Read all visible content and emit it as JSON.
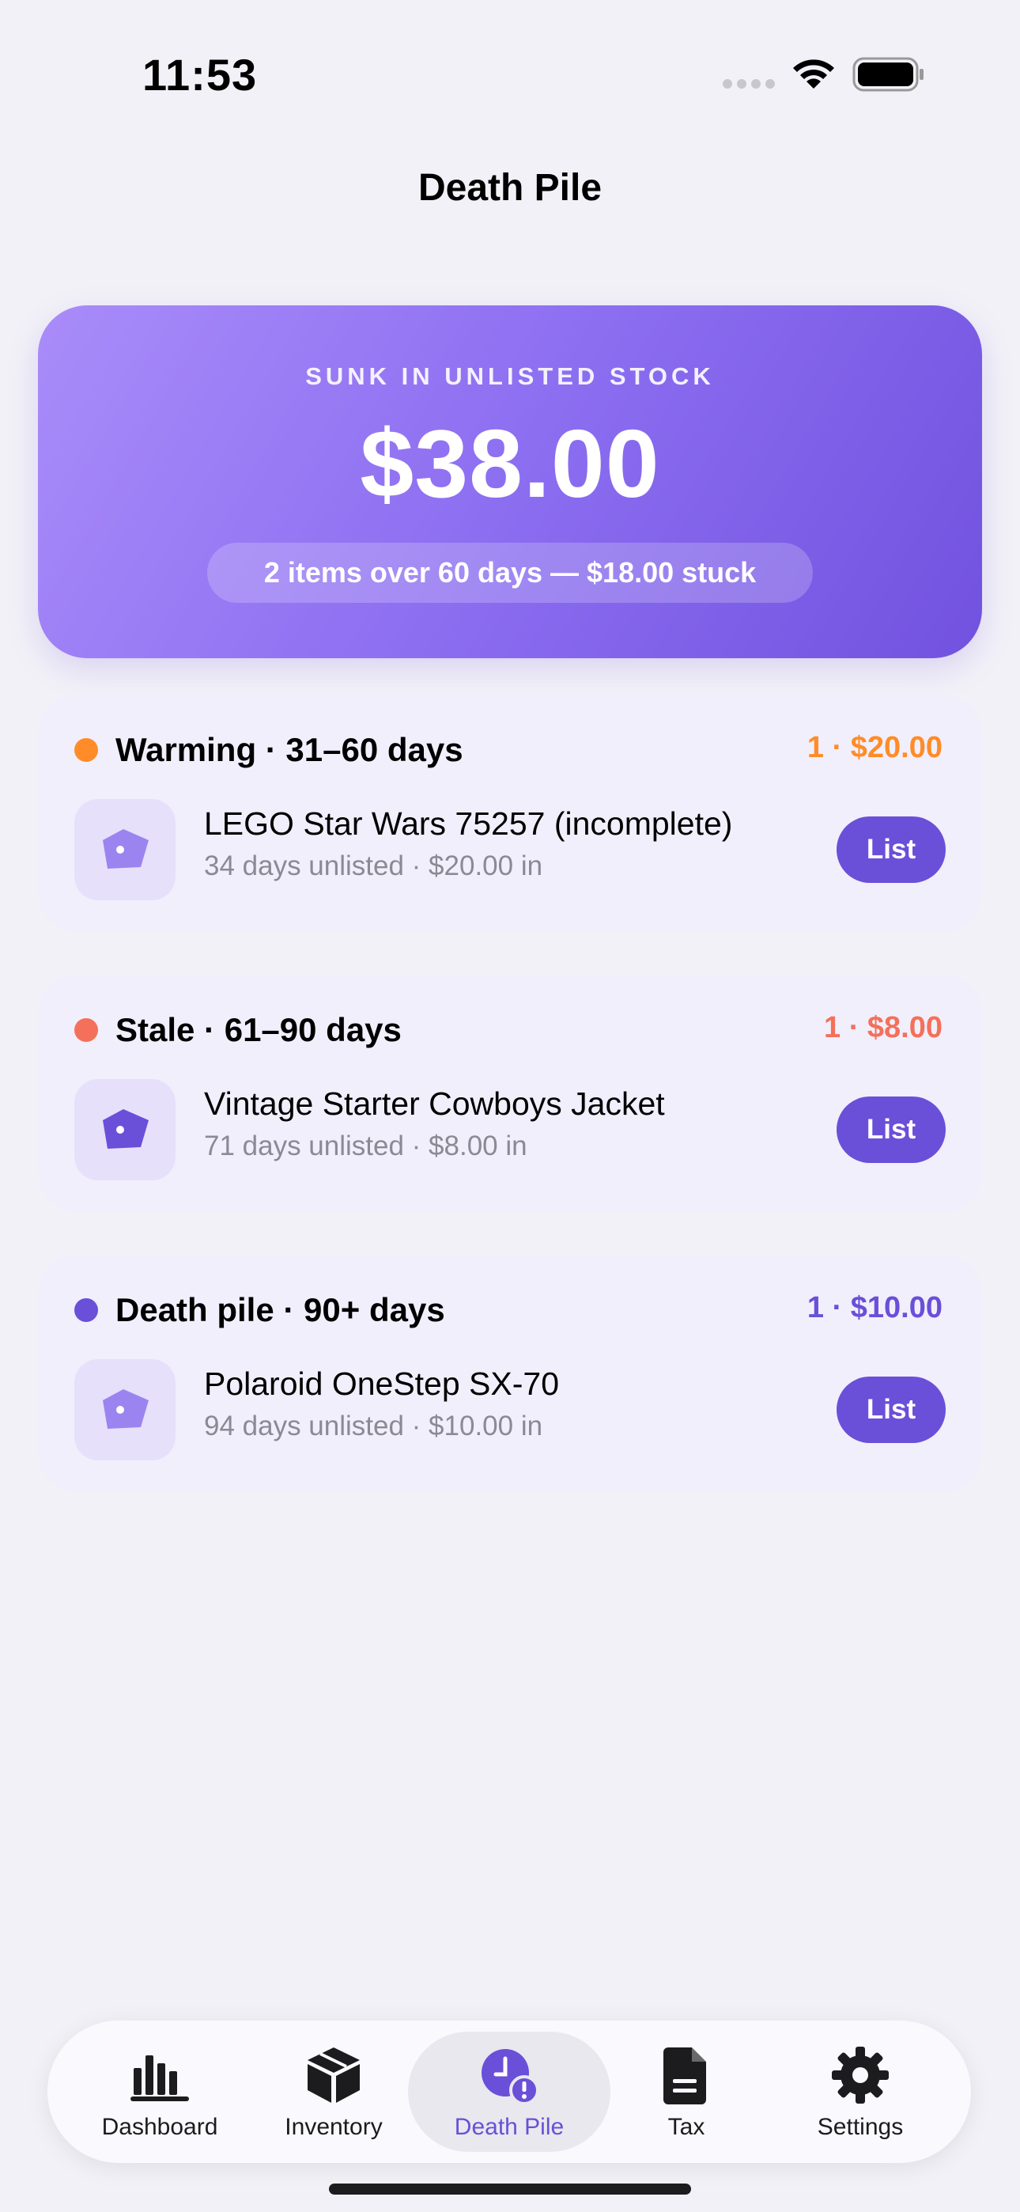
{
  "status_bar": {
    "time": "11:53"
  },
  "nav": {
    "title": "Death Pile"
  },
  "hero": {
    "label": "SUNK IN UNLISTED STOCK",
    "amount": "$38.00",
    "pill": "2 items over 60 days — $18.00 stuck"
  },
  "buckets": [
    {
      "title": "Warming · 31–60 days",
      "summary": "1 · $20.00",
      "color": "#ff8c28",
      "items": [
        {
          "name": "LEGO Star Wars 75257 (incomplete)",
          "meta": "34 days unlisted · $20.00 in",
          "action": "List",
          "icon": "tag-icon",
          "icon_color": "#9b84f0"
        }
      ]
    },
    {
      "title": "Stale · 61–90 days",
      "summary": "1 · $8.00",
      "color": "#f4705a",
      "items": [
        {
          "name": "Vintage Starter Cowboys Jacket",
          "meta": "71 days unlisted · $8.00 in",
          "action": "List",
          "icon": "tag-icon",
          "icon_color": "#6a4fd9"
        }
      ]
    },
    {
      "title": "Death pile · 90+ days",
      "summary": "1 · $10.00",
      "color": "#6a4fd9",
      "items": [
        {
          "name": "Polaroid OneStep SX-70",
          "meta": "94 days unlisted · $10.00 in",
          "action": "List",
          "icon": "tag-icon",
          "icon_color": "#9b84f0"
        }
      ]
    }
  ],
  "tabs": [
    {
      "label": "Dashboard",
      "icon": "chart-bars-icon",
      "active": false
    },
    {
      "label": "Inventory",
      "icon": "box-icon",
      "active": false
    },
    {
      "label": "Death Pile",
      "icon": "clock-alert-icon",
      "active": true
    },
    {
      "label": "Tax",
      "icon": "document-icon",
      "active": false
    },
    {
      "label": "Settings",
      "icon": "gear-icon",
      "active": false
    }
  ],
  "colors": {
    "accent": "#6a4fd9",
    "background": "#f2f1f7"
  }
}
